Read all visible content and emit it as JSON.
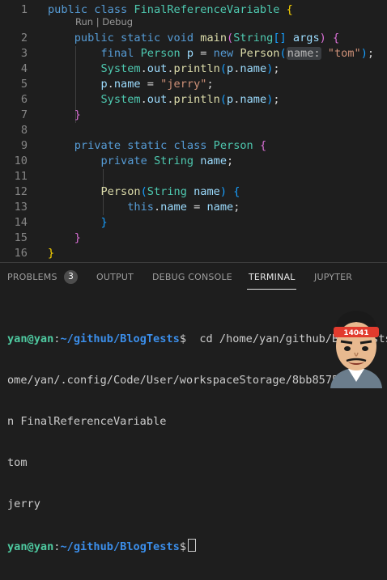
{
  "editor": {
    "codelens": "Run | Debug",
    "lines": [
      {
        "n": "1",
        "tokens": [
          [
            "k",
            "public"
          ],
          [
            "p",
            " "
          ],
          [
            "k",
            "class"
          ],
          [
            "p",
            " "
          ],
          [
            "ty",
            "FinalReferenceVariable"
          ],
          [
            "p",
            " "
          ],
          [
            "br1",
            "{"
          ]
        ]
      },
      {
        "n": "2",
        "tokens": [
          [
            "p",
            "    "
          ],
          [
            "k",
            "public"
          ],
          [
            "p",
            " "
          ],
          [
            "k",
            "static"
          ],
          [
            "p",
            " "
          ],
          [
            "k",
            "void"
          ],
          [
            "p",
            " "
          ],
          [
            "fn",
            "main"
          ],
          [
            "br2",
            "("
          ],
          [
            "ty",
            "String"
          ],
          [
            "br3",
            "[]"
          ],
          [
            "p",
            " "
          ],
          [
            "v",
            "args"
          ],
          [
            "br2",
            ")"
          ],
          [
            "p",
            " "
          ],
          [
            "br2",
            "{"
          ]
        ]
      },
      {
        "n": "3",
        "tokens": [
          [
            "p",
            "        "
          ],
          [
            "k",
            "final"
          ],
          [
            "p",
            " "
          ],
          [
            "ty",
            "Person"
          ],
          [
            "p",
            " "
          ],
          [
            "v",
            "p"
          ],
          [
            "p",
            " = "
          ],
          [
            "k",
            "new"
          ],
          [
            "p",
            " "
          ],
          [
            "fn",
            "Person"
          ],
          [
            "br3",
            "("
          ],
          [
            "hint",
            "name:"
          ],
          [
            "p",
            " "
          ],
          [
            "s",
            "\"tom\""
          ],
          [
            "br3",
            ")"
          ],
          [
            "p",
            ";"
          ]
        ]
      },
      {
        "n": "4",
        "tokens": [
          [
            "p",
            "        "
          ],
          [
            "ty",
            "System"
          ],
          [
            "p",
            "."
          ],
          [
            "v",
            "out"
          ],
          [
            "p",
            "."
          ],
          [
            "fn",
            "println"
          ],
          [
            "br3",
            "("
          ],
          [
            "v",
            "p"
          ],
          [
            "p",
            "."
          ],
          [
            "v",
            "name"
          ],
          [
            "br3",
            ")"
          ],
          [
            "p",
            ";"
          ]
        ]
      },
      {
        "n": "5",
        "tokens": [
          [
            "p",
            "        "
          ],
          [
            "v",
            "p"
          ],
          [
            "p",
            "."
          ],
          [
            "v",
            "name"
          ],
          [
            "p",
            " = "
          ],
          [
            "s",
            "\"jerry\""
          ],
          [
            "p",
            ";"
          ]
        ]
      },
      {
        "n": "6",
        "tokens": [
          [
            "p",
            "        "
          ],
          [
            "ty",
            "System"
          ],
          [
            "p",
            "."
          ],
          [
            "v",
            "out"
          ],
          [
            "p",
            "."
          ],
          [
            "fn",
            "println"
          ],
          [
            "br3",
            "("
          ],
          [
            "v",
            "p"
          ],
          [
            "p",
            "."
          ],
          [
            "v",
            "name"
          ],
          [
            "br3",
            ")"
          ],
          [
            "p",
            ";"
          ]
        ]
      },
      {
        "n": "7",
        "tokens": [
          [
            "p",
            "    "
          ],
          [
            "br2",
            "}"
          ]
        ]
      },
      {
        "n": "8",
        "tokens": []
      },
      {
        "n": "9",
        "tokens": [
          [
            "p",
            "    "
          ],
          [
            "k",
            "private"
          ],
          [
            "p",
            " "
          ],
          [
            "k",
            "static"
          ],
          [
            "p",
            " "
          ],
          [
            "k",
            "class"
          ],
          [
            "p",
            " "
          ],
          [
            "ty",
            "Person"
          ],
          [
            "p",
            " "
          ],
          [
            "br2",
            "{"
          ]
        ]
      },
      {
        "n": "10",
        "tokens": [
          [
            "p",
            "        "
          ],
          [
            "k",
            "private"
          ],
          [
            "p",
            " "
          ],
          [
            "ty",
            "String"
          ],
          [
            "p",
            " "
          ],
          [
            "v",
            "name"
          ],
          [
            "p",
            ";"
          ]
        ]
      },
      {
        "n": "11",
        "tokens": []
      },
      {
        "n": "12",
        "tokens": [
          [
            "p",
            "        "
          ],
          [
            "fn",
            "Person"
          ],
          [
            "br3",
            "("
          ],
          [
            "ty",
            "String"
          ],
          [
            "p",
            " "
          ],
          [
            "v",
            "name"
          ],
          [
            "br3",
            ")"
          ],
          [
            "p",
            " "
          ],
          [
            "br3",
            "{"
          ]
        ]
      },
      {
        "n": "13",
        "tokens": [
          [
            "p",
            "            "
          ],
          [
            "k",
            "this"
          ],
          [
            "p",
            "."
          ],
          [
            "v",
            "name"
          ],
          [
            "p",
            " = "
          ],
          [
            "v",
            "name"
          ],
          [
            "p",
            ";"
          ]
        ]
      },
      {
        "n": "14",
        "tokens": [
          [
            "p",
            "        "
          ],
          [
            "br3",
            "}"
          ]
        ]
      },
      {
        "n": "15",
        "tokens": [
          [
            "p",
            "    "
          ],
          [
            "br2",
            "}"
          ]
        ]
      },
      {
        "n": "16",
        "tokens": [
          [
            "br1",
            "}"
          ]
        ]
      }
    ]
  },
  "panel": {
    "tabs": [
      {
        "label": "PROBLEMS",
        "active": false
      },
      {
        "label": "OUTPUT",
        "active": false
      },
      {
        "label": "DEBUG CONSOLE",
        "active": false
      },
      {
        "label": "TERMINAL",
        "active": true
      },
      {
        "label": "JUPYTER",
        "active": false
      }
    ],
    "problems_count": "3"
  },
  "terminal": {
    "user": "yan@yan",
    "sep": ":",
    "path": "~/github/BlogTests",
    "dollar": "$",
    "command": "  cd /home/yan/github/BlogTests",
    "wrap1": "ome/yan/.config/Code/User/workspaceStorage/8bb8575",
    "wrap2": "n FinalReferenceVariable",
    "out1": "tom",
    "out2": "jerry"
  },
  "avatar": {
    "badge_text": "14041"
  },
  "colors": {
    "accent": "#4ec9a0",
    "path": "#3b8eea",
    "keyword": "#569cd6",
    "type": "#4ec9b0",
    "string": "#ce9178"
  }
}
